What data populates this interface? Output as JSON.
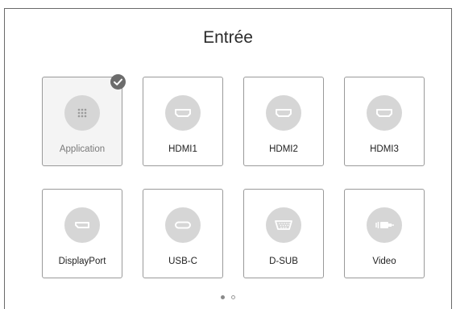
{
  "header": {
    "title": "Entrée"
  },
  "inputs": [
    {
      "label": "Application",
      "icon": "app-grid-icon",
      "selected": true
    },
    {
      "label": "HDMI1",
      "icon": "hdmi-port-icon",
      "selected": false
    },
    {
      "label": "HDMI2",
      "icon": "hdmi-port-icon",
      "selected": false
    },
    {
      "label": "HDMI3",
      "icon": "hdmi-port-icon",
      "selected": false
    },
    {
      "label": "DisplayPort",
      "icon": "displayport-icon",
      "selected": false
    },
    {
      "label": "USB-C",
      "icon": "usb-c-port-icon",
      "selected": false
    },
    {
      "label": "D-SUB",
      "icon": "vga-port-icon",
      "selected": false
    },
    {
      "label": "Video",
      "icon": "av-plug-icon",
      "selected": false
    }
  ],
  "pagination": {
    "pages": 2,
    "current": 1
  },
  "colors": {
    "icon_circle": "#d6d6d6",
    "check_badge": "#6c6c6c",
    "tile_border": "#9a9a9a"
  }
}
